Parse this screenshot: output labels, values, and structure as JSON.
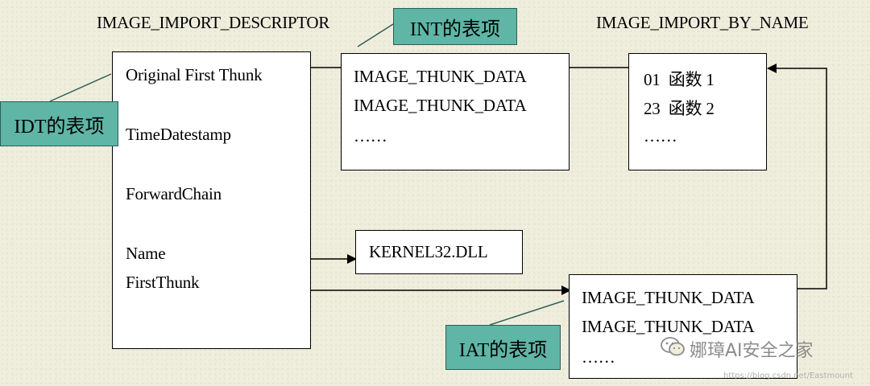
{
  "headings": {
    "descriptor": "IMAGE_IMPORT_DESCRIPTOR",
    "by_name": "IMAGE_IMPORT_BY_NAME"
  },
  "descriptor_fields": {
    "original_first_thunk": "Original First Thunk",
    "time_date_stamp": "TimeDatestamp",
    "forwarder_chain": "ForwardChain",
    "name": "Name",
    "first_thunk": "FirstThunk"
  },
  "int_box": {
    "row1": "IMAGE_THUNK_DATA",
    "row2": "IMAGE_THUNK_DATA",
    "more": "……"
  },
  "by_name_box": {
    "row1": "01  函数 1",
    "row2": "23  函数 2",
    "more": "……"
  },
  "dll_box": {
    "label": "KERNEL32.DLL"
  },
  "iat_box": {
    "row1": "IMAGE_THUNK_DATA",
    "row2": "IMAGE_THUNK_DATA",
    "more": "……"
  },
  "tags": {
    "int": "INT的表项",
    "idt": "IDT的表项",
    "iat": "IAT的表项"
  },
  "watermark": {
    "text": "娜璋AI安全之家",
    "url": "https://blog.csdn.net/Eastmount"
  },
  "colors": {
    "tag_fill": "#5fb5a6",
    "background": "#efeedd"
  }
}
